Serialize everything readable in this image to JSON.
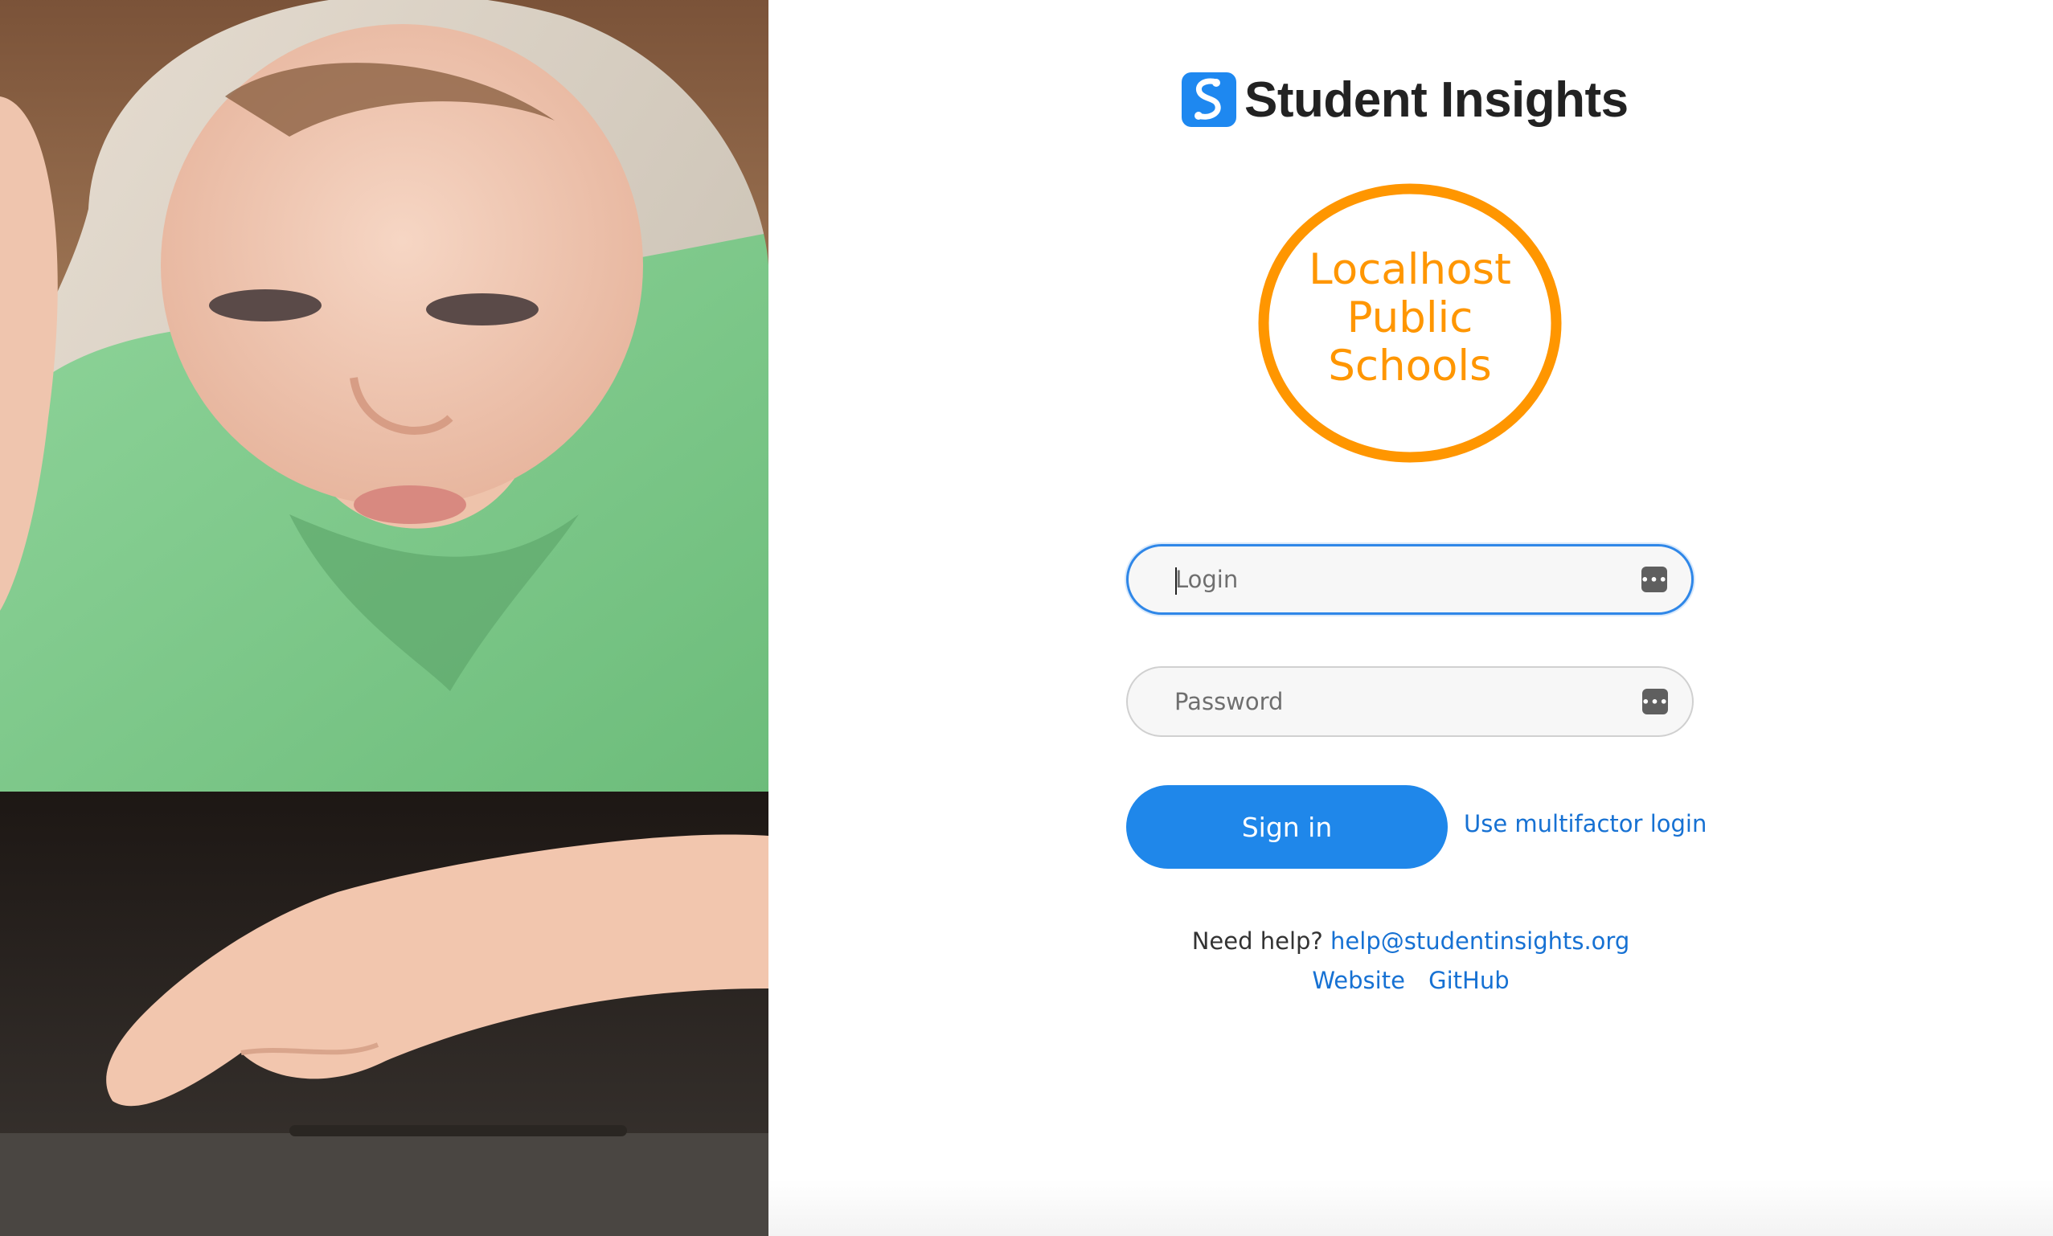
{
  "app": {
    "title": "Student Insights",
    "logo_icon": "student-insights-logo-icon",
    "accent_color": "#1e88f0"
  },
  "district": {
    "line1": "Localhost",
    "line2": "Public",
    "line3": "Schools",
    "color": "#ff9600"
  },
  "form": {
    "login_placeholder": "Login",
    "password_placeholder": "Password",
    "password_manager_icon": "password-manager-icon",
    "submit_label": "Sign in",
    "multifactor_link": "Use multifactor login"
  },
  "footer": {
    "help_text": "Need help?",
    "help_email": "help@studentinsights.org",
    "website_link": "Website",
    "github_link": "GitHub"
  }
}
